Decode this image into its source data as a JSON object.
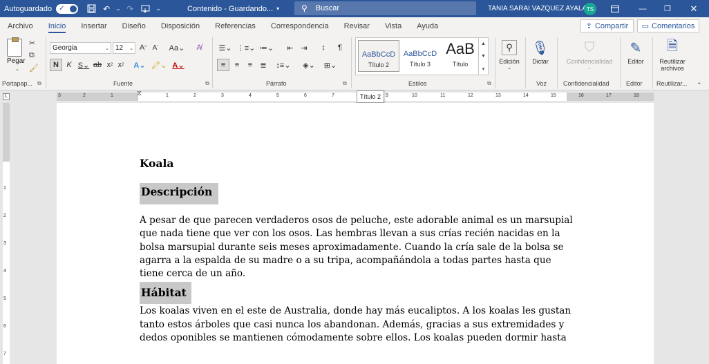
{
  "titlebar": {
    "autosave_label": "Autoguardado",
    "doc_title": "Contenido - Guardando...",
    "search_placeholder": "Buscar",
    "user_name": "TANIA SARAI VAZQUEZ AYALA",
    "user_initials": "TS",
    "accent_color": "#2b579a"
  },
  "tabs": [
    {
      "label": "Archivo"
    },
    {
      "label": "Inicio",
      "active": true
    },
    {
      "label": "Insertar"
    },
    {
      "label": "Diseño"
    },
    {
      "label": "Disposición"
    },
    {
      "label": "Referencias"
    },
    {
      "label": "Correspondencia"
    },
    {
      "label": "Revisar"
    },
    {
      "label": "Vista"
    },
    {
      "label": "Ayuda"
    }
  ],
  "share_label": "Compartir",
  "comments_label": "Comentarios",
  "ribbon": {
    "clipboard": {
      "paste_label": "Pegar",
      "group_label": "Portapap..."
    },
    "font": {
      "font_name": "Georgia",
      "font_size": "12",
      "group_label": "Fuente"
    },
    "paragraph": {
      "group_label": "Párrafo"
    },
    "styles": {
      "group_label": "Estilos",
      "items": [
        {
          "sample": "AaBbCcD",
          "name": "Título 2"
        },
        {
          "sample": "AaBbCcD",
          "name": "Título 3"
        },
        {
          "sample": "AaB",
          "name": "Título"
        }
      ]
    },
    "edicion_label": "Edición",
    "dictar_label": "Dictar",
    "voz_group_label": "Voz",
    "confidencialidad_label": "Confidencialidad",
    "confidencialidad_group_label": "Confidencialidad",
    "editor_label": "Editor",
    "editor_group_label": "Editor",
    "reutilizar_line1": "Reutilizar",
    "reutilizar_line2": "archivos",
    "reutilizar_group_label": "Reutilizar..."
  },
  "tooltip": "Título 2",
  "ruler": {
    "numbers": [
      "3",
      "2",
      "1",
      "1",
      "2",
      "3",
      "4",
      "5",
      "6",
      "7",
      "9",
      "10",
      "11",
      "12",
      "13",
      "14",
      "15",
      "16",
      "17",
      "18"
    ],
    "vnumbers": [
      "1",
      "2",
      "3",
      "4",
      "5",
      "6",
      "7"
    ]
  },
  "document": {
    "title": "Koala",
    "sections": [
      {
        "heading": "Descripción",
        "body": "A pesar de que parecen verdaderos osos de peluche, este adorable animal es un marsupial que nada tiene que ver con los osos. Las hembras llevan a sus crías recién nacidas en la bolsa marsupial durante seis meses aproximadamente. Cuando la cría sale de la bolsa se agarra a la espalda de su madre o a su tripa, acompañándola a todas partes hasta que tiene cerca de un año."
      },
      {
        "heading": "Hábitat",
        "body": "Los koalas viven en el este de Australia, donde hay más eucaliptos. A los koalas les gustan tanto estos árboles que casi nunca los abandonan. Además, gracias a sus extremidades y dedos oponibles se mantienen cómodamente sobre ellos. Los koalas pueden dormir hasta"
      }
    ]
  }
}
